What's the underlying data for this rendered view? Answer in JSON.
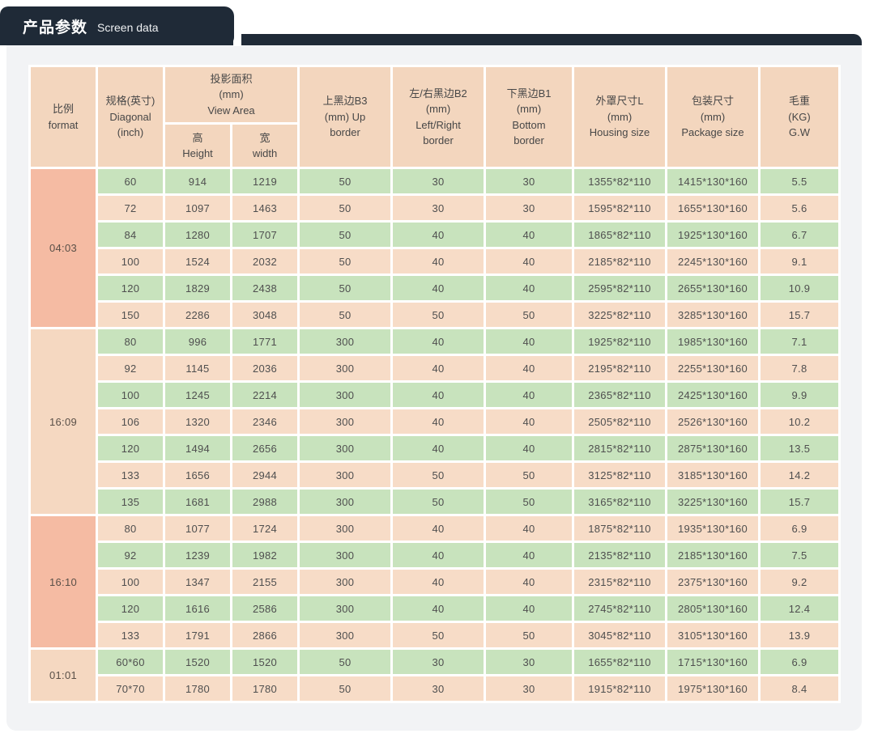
{
  "title": {
    "zh": "产品参数",
    "en": "Screen data"
  },
  "colors": {
    "header_bar": "#1f2a37",
    "panel_bg": "#f2f3f5",
    "row_green": "#c8e3bd",
    "row_peach": "#f7dcc7",
    "group_dark": "#f5bba3",
    "group_light": "#f5d8c1",
    "header_cell": "#f3d6be"
  },
  "table": {
    "headers": {
      "format": "比例\nformat",
      "diagonal": "规格(英寸)\nDiagonal\n(inch)",
      "view_area": "投影面积\n(mm)\nView Area",
      "height": "高\nHeight",
      "width": "宽\nwidth",
      "up_border": "上黑边B3\n(mm)   Up\nborder",
      "lr_border": "左/右黑边B2\n(mm)\nLeft/Right\nborder",
      "bottom_border": "下黑边B1\n(mm)\nBottom\nborder",
      "housing": "外罩尺寸L\n(mm)\nHousing size",
      "package": "包装尺寸\n(mm)\nPackage size",
      "gross_weight": "毛重\n(KG)\nG.W"
    },
    "columns": [
      "format",
      "diagonal",
      "height",
      "width",
      "up-border",
      "left-right-border",
      "bottom-border",
      "housing-size",
      "package-size",
      "gross-weight"
    ],
    "groups": [
      {
        "format": "04:03",
        "shade": "dark",
        "rows": [
          [
            "60",
            "914",
            "1219",
            "50",
            "30",
            "30",
            "1355*82*110",
            "1415*130*160",
            "5.5"
          ],
          [
            "72",
            "1097",
            "1463",
            "50",
            "30",
            "30",
            "1595*82*110",
            "1655*130*160",
            "5.6"
          ],
          [
            "84",
            "1280",
            "1707",
            "50",
            "40",
            "40",
            "1865*82*110",
            "1925*130*160",
            "6.7"
          ],
          [
            "100",
            "1524",
            "2032",
            "50",
            "40",
            "40",
            "2185*82*110",
            "2245*130*160",
            "9.1"
          ],
          [
            "120",
            "1829",
            "2438",
            "50",
            "40",
            "40",
            "2595*82*110",
            "2655*130*160",
            "10.9"
          ],
          [
            "150",
            "2286",
            "3048",
            "50",
            "50",
            "50",
            "3225*82*110",
            "3285*130*160",
            "15.7"
          ]
        ]
      },
      {
        "format": "16:09",
        "shade": "light",
        "rows": [
          [
            "80",
            "996",
            "1771",
            "300",
            "40",
            "40",
            "1925*82*110",
            "1985*130*160",
            "7.1"
          ],
          [
            "92",
            "1145",
            "2036",
            "300",
            "40",
            "40",
            "2195*82*110",
            "2255*130*160",
            "7.8"
          ],
          [
            "100",
            "1245",
            "2214",
            "300",
            "40",
            "40",
            "2365*82*110",
            "2425*130*160",
            "9.9"
          ],
          [
            "106",
            "1320",
            "2346",
            "300",
            "40",
            "40",
            "2505*82*110",
            "2526*130*160",
            "10.2"
          ],
          [
            "120",
            "1494",
            "2656",
            "300",
            "40",
            "40",
            "2815*82*110",
            "2875*130*160",
            "13.5"
          ],
          [
            "133",
            "1656",
            "2944",
            "300",
            "50",
            "50",
            "3125*82*110",
            "3185*130*160",
            "14.2"
          ],
          [
            "135",
            "1681",
            "2988",
            "300",
            "50",
            "50",
            "3165*82*110",
            "3225*130*160",
            "15.7"
          ]
        ]
      },
      {
        "format": "16:10",
        "shade": "dark",
        "rows": [
          [
            "80",
            "1077",
            "1724",
            "300",
            "40",
            "40",
            "1875*82*110",
            "1935*130*160",
            "6.9"
          ],
          [
            "92",
            "1239",
            "1982",
            "300",
            "40",
            "40",
            "2135*82*110",
            "2185*130*160",
            "7.5"
          ],
          [
            "100",
            "1347",
            "2155",
            "300",
            "40",
            "40",
            "2315*82*110",
            "2375*130*160",
            "9.2"
          ],
          [
            "120",
            "1616",
            "2586",
            "300",
            "40",
            "40",
            "2745*82*110",
            "2805*130*160",
            "12.4"
          ],
          [
            "133",
            "1791",
            "2866",
            "300",
            "50",
            "50",
            "3045*82*110",
            "3105*130*160",
            "13.9"
          ]
        ]
      },
      {
        "format": "01:01",
        "shade": "light",
        "rows": [
          [
            "60*60",
            "1520",
            "1520",
            "50",
            "30",
            "30",
            "1655*82*110",
            "1715*130*160",
            "6.9"
          ],
          [
            "70*70",
            "1780",
            "1780",
            "50",
            "30",
            "30",
            "1915*82*110",
            "1975*130*160",
            "8.4"
          ]
        ]
      }
    ]
  }
}
